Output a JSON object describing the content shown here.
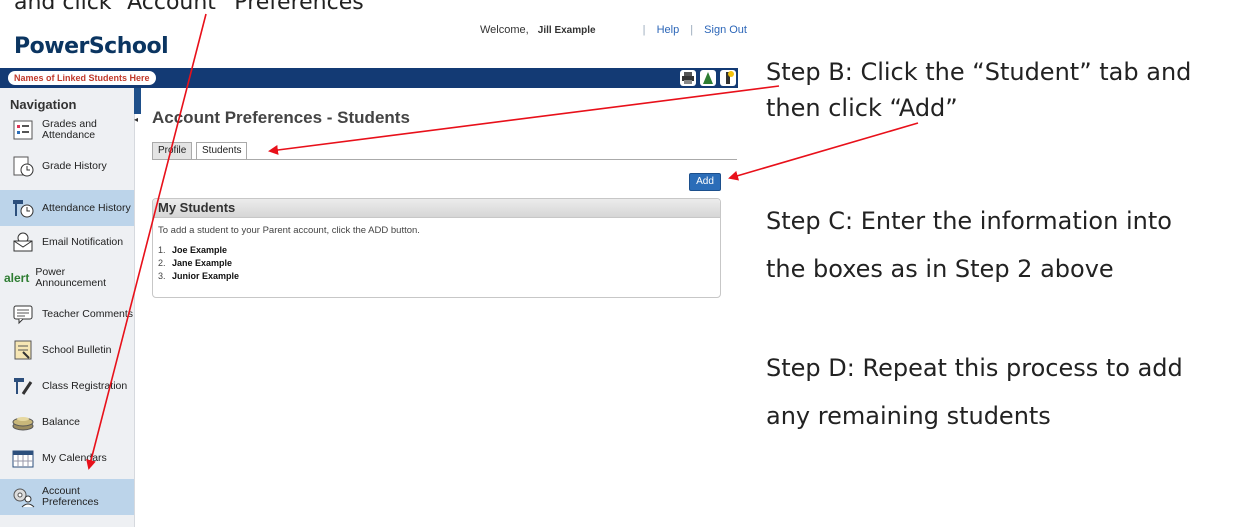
{
  "caption_top": "and click “Account” Preferences",
  "logo": "PowerSchool",
  "header": {
    "welcome": "Welcome,",
    "user": "Jill Example",
    "help": "Help",
    "sign_out": "Sign Out"
  },
  "linked_students_label": "Names of Linked Students Here",
  "navigation": {
    "title": "Navigation",
    "items": [
      {
        "label": "Grades and Attendance",
        "icon": "grades-icon"
      },
      {
        "label": "Grade History",
        "icon": "grade-history-icon"
      },
      {
        "label": "Attendance History",
        "icon": "attendance-icon"
      },
      {
        "label": "Email Notification",
        "icon": "email-icon"
      },
      {
        "label": "Power Announcement",
        "icon": "alert-icon"
      },
      {
        "label": "Teacher Comments",
        "icon": "comments-icon"
      },
      {
        "label": "School Bulletin",
        "icon": "bulletin-icon"
      },
      {
        "label": "Class Registration",
        "icon": "registration-icon"
      },
      {
        "label": "Balance",
        "icon": "balance-icon"
      },
      {
        "label": "My Calendars",
        "icon": "calendar-icon"
      },
      {
        "label": "Account Preferences",
        "icon": "preferences-icon"
      }
    ]
  },
  "page": {
    "title": "Account Preferences - Students",
    "tabs": [
      "Profile",
      "Students"
    ],
    "add_button": "Add",
    "panel_title": "My Students",
    "panel_text": "To add a student to your Parent account, click the ADD button.",
    "students": [
      {
        "num": "1.",
        "name": "Joe Example"
      },
      {
        "num": "2.",
        "name": "Jane Example"
      },
      {
        "num": "3.",
        "name": "Junior Example"
      }
    ]
  },
  "steps": {
    "b_line1": "Step B: Click the “Student” tab and",
    "b_line2": "then click “Add”",
    "c_line1": "Step C: Enter the information into",
    "c_line2": "the boxes as in Step 2 above",
    "d_line1": "Step D: Repeat this process to add",
    "d_line2": "any remaining students"
  },
  "colors": {
    "brand_navy": "#133a74",
    "arrow_red": "#e8101a",
    "active_nav": "#bcd4ea",
    "button_blue": "#2b6db8"
  }
}
